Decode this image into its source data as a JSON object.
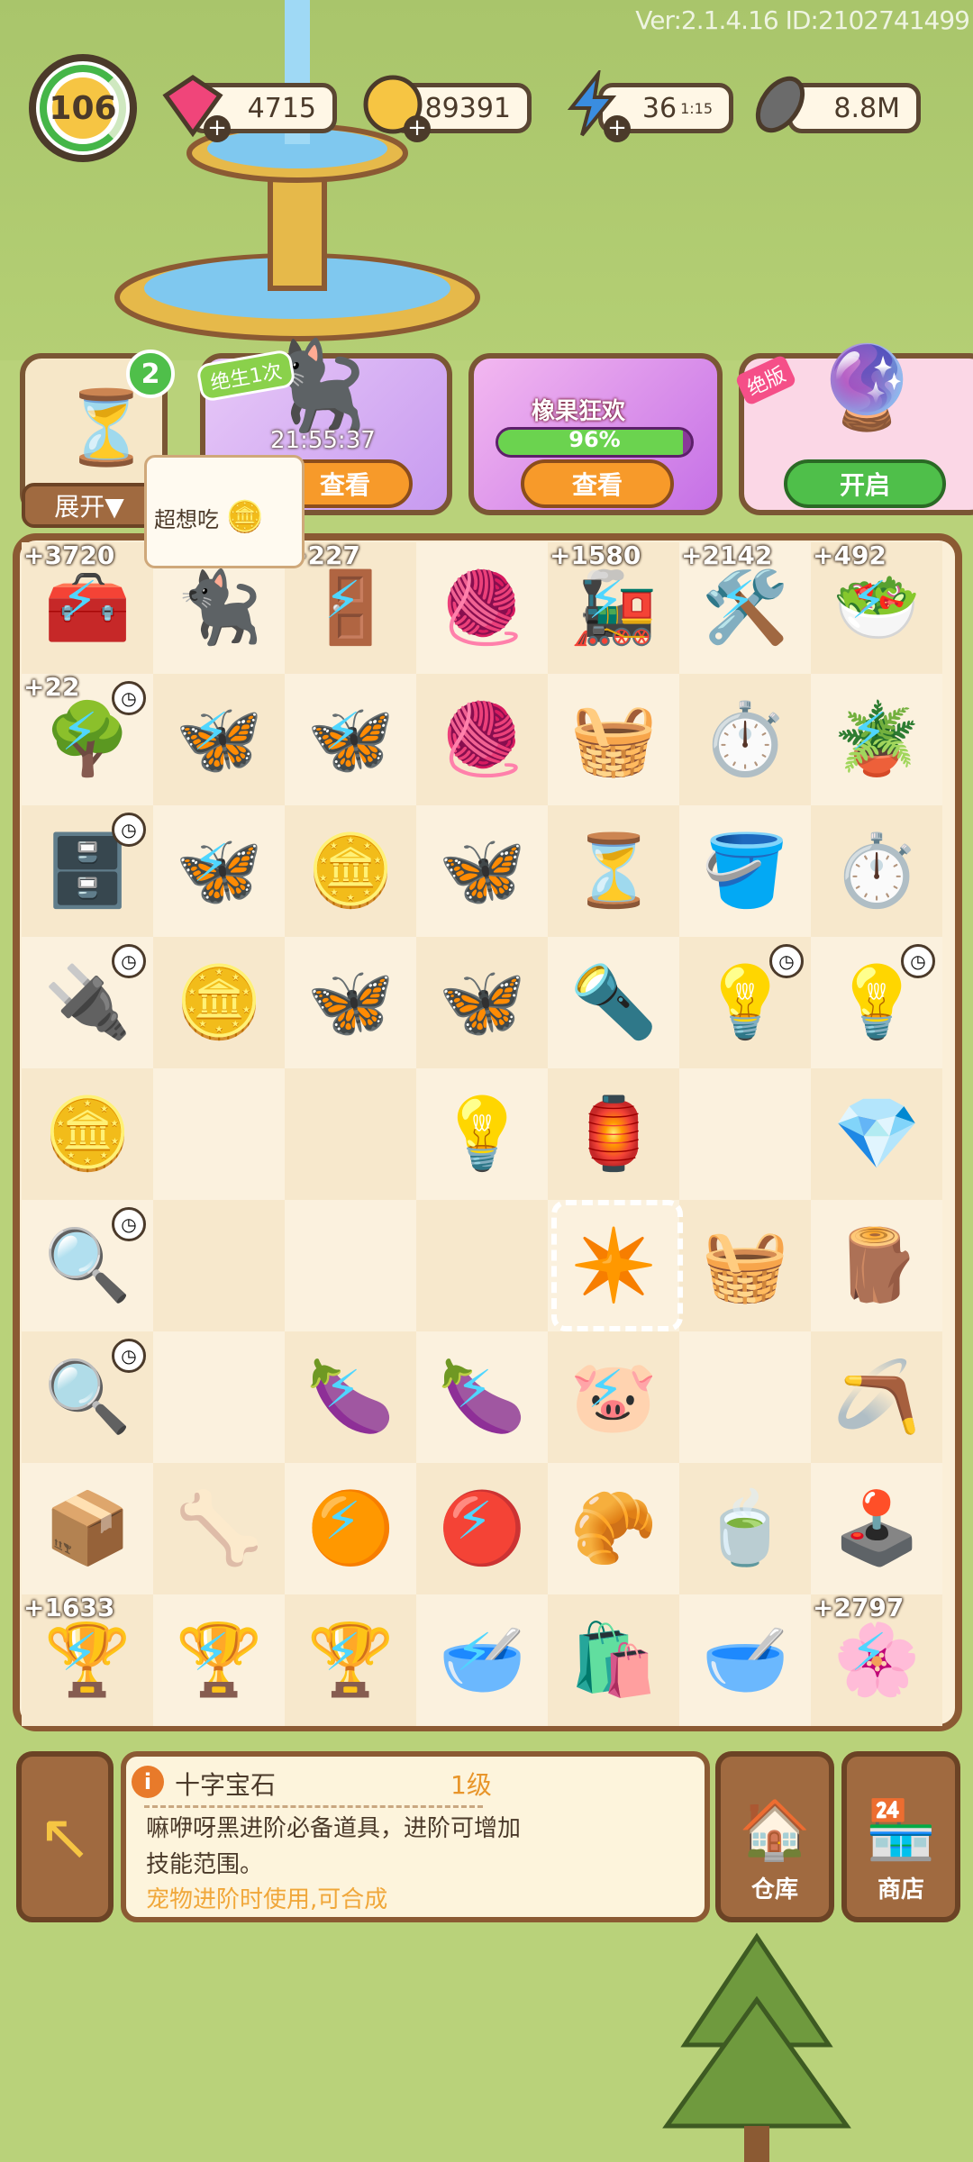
{
  "version": "Ver:2.1.4.16 ID:2102741499",
  "level": "106",
  "resources": [
    {
      "name": "gems",
      "value": "4715",
      "icon": "gem-icon"
    },
    {
      "name": "coins",
      "value": "89391",
      "icon": "coin-icon"
    },
    {
      "name": "energy",
      "value": "36",
      "sub": "1:15",
      "icon": "lightning-icon"
    },
    {
      "name": "seeds",
      "value": "8.8M",
      "icon": "seed-icon"
    }
  ],
  "events": {
    "hourglass": {
      "badge": "2",
      "expand": "展开▼"
    },
    "pet": {
      "tag": "绝生1次",
      "timer": "21:55:37",
      "button": "查看"
    },
    "festival": {
      "title": "橡果狂欢",
      "percent": "96%",
      "progress": 0.96,
      "button": "查看"
    },
    "globe": {
      "badge": "绝版",
      "button": "开启"
    }
  },
  "tip": "超想吃",
  "board": [
    [
      {
        "i": "🧰",
        "c": "+3720",
        "b": 1
      },
      {
        "i": "🐈‍⬛"
      },
      {
        "i": "🚪",
        "c": "+227",
        "b": 1
      },
      {
        "i": "🧶"
      },
      {
        "i": "🚂",
        "c": "+1580",
        "b": 1
      },
      {
        "i": "🛠️",
        "c": "+2142",
        "b": 1
      },
      {
        "i": "🥗",
        "c": "+492",
        "b": 1
      }
    ],
    [
      {
        "i": "🌳",
        "c": "+22",
        "b": 1,
        "k": 1
      },
      {
        "i": "🦋",
        "b": 1
      },
      {
        "i": "🦋",
        "b": 1
      },
      {
        "i": "🧶"
      },
      {
        "i": "🧺"
      },
      {
        "i": "⏱️"
      },
      {
        "i": "🪴",
        "b": 1
      }
    ],
    [
      {
        "i": "🗄️",
        "k": 1
      },
      {
        "i": "🦋",
        "b": 1
      },
      {
        "i": "🪙"
      },
      {
        "i": "🦋"
      },
      {
        "i": "⏳"
      },
      {
        "i": "🪣"
      },
      {
        "i": "⏱️"
      }
    ],
    [
      {
        "i": "🔌",
        "k": 1
      },
      {
        "i": "🪙"
      },
      {
        "i": "🦋"
      },
      {
        "i": "🦋"
      },
      {
        "i": "🔦"
      },
      {
        "i": "💡",
        "k": 1
      },
      {
        "i": "💡",
        "k": 1
      }
    ],
    [
      {
        "i": "🪙"
      },
      {
        "i": ""
      },
      {
        "i": ""
      },
      {
        "i": "💡"
      },
      {
        "i": "🏮"
      },
      {
        "i": ""
      },
      {
        "i": "💎"
      }
    ],
    [
      {
        "i": "🔍",
        "k": 1
      },
      {
        "i": ""
      },
      {
        "i": ""
      },
      {
        "i": ""
      },
      {
        "i": "✴️"
      },
      {
        "i": "🧺"
      },
      {
        "i": "🪵"
      }
    ],
    [
      {
        "i": "🔍",
        "k": 1
      },
      {
        "i": ""
      },
      {
        "i": "🍆",
        "b": 1
      },
      {
        "i": "🍆",
        "b": 1
      },
      {
        "i": "🐷",
        "b": 1
      },
      {
        "i": ""
      },
      {
        "i": "🪃"
      }
    ],
    [
      {
        "i": "📦"
      },
      {
        "i": "🦴"
      },
      {
        "i": "🟠",
        "b": 1
      },
      {
        "i": "🔴",
        "b": 1
      },
      {
        "i": "🥐"
      },
      {
        "i": "🍵"
      },
      {
        "i": "🕹️"
      }
    ],
    [
      {
        "i": "🏆",
        "c": "+1633",
        "b": 1
      },
      {
        "i": "🏆",
        "b": 1
      },
      {
        "i": "🏆",
        "b": 1
      },
      {
        "i": "🥣",
        "b": 1
      },
      {
        "i": "🛍️"
      },
      {
        "i": "🥣"
      },
      {
        "i": "🌸",
        "c": "+2797",
        "b": 1
      }
    ]
  ],
  "info": {
    "icon": "i",
    "title": "十字宝石",
    "level": "1级",
    "desc": "嘛咿呀黑进阶必备道具，进阶可增加技能范围。",
    "use": "宠物进阶时使用,可合成"
  },
  "buttons": {
    "warehouse": "仓库",
    "shop": "商店"
  }
}
